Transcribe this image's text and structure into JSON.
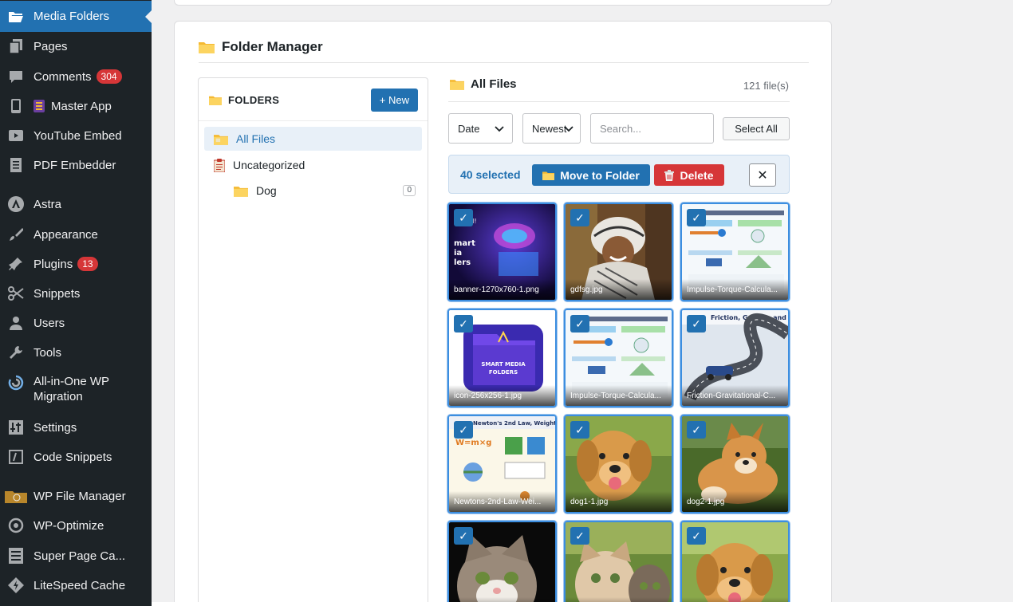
{
  "sidebar": {
    "items": [
      {
        "label": "Media Folders",
        "icon": "folder-open-icon",
        "active": true
      },
      {
        "label": "Pages",
        "icon": "pages-icon"
      },
      {
        "label": "Comments",
        "icon": "comment-icon",
        "badge": "304"
      },
      {
        "label": "Master App",
        "icon": "mobile-icon",
        "prefix_icon": "app-logo-icon"
      },
      {
        "label": "YouTube Embed",
        "icon": "video-icon"
      },
      {
        "label": "PDF Embedder",
        "icon": "document-icon"
      },
      {
        "label": "Astra",
        "icon": "astra-icon"
      },
      {
        "label": "Appearance",
        "icon": "brush-icon"
      },
      {
        "label": "Plugins",
        "icon": "plugin-icon",
        "badge": "13"
      },
      {
        "label": "Snippets",
        "icon": "scissors-icon"
      },
      {
        "label": "Users",
        "icon": "user-icon"
      },
      {
        "label": "Tools",
        "icon": "wrench-icon"
      },
      {
        "label": "All-in-One WP Migration",
        "icon": "migration-icon"
      },
      {
        "label": "Settings",
        "icon": "sliders-icon"
      },
      {
        "label": "Code Snippets",
        "icon": "code-icon"
      },
      {
        "label": "WP File Manager",
        "icon": "file-manager-icon"
      },
      {
        "label": "WP-Optimize",
        "icon": "optimize-icon"
      },
      {
        "label": "Super Page Ca...",
        "icon": "cache-icon"
      },
      {
        "label": "LiteSpeed Cache",
        "icon": "litespeed-icon"
      }
    ]
  },
  "folder_manager": {
    "title": "Folder Manager",
    "folders_panel": {
      "title": "FOLDERS",
      "new_button": "+ New",
      "items": [
        {
          "label": "All Files",
          "selected": true
        },
        {
          "label": "Uncategorized"
        },
        {
          "label": "Dog",
          "count": "0"
        }
      ]
    },
    "files_panel": {
      "title": "All Files",
      "file_count": "121 file(s)",
      "sort_by": "Date",
      "order": "Newest",
      "search_placeholder": "Search...",
      "select_all": "Select All",
      "selection": {
        "count_text": "40 selected",
        "move_button": "Move to Folder",
        "delete_button": "Delete",
        "close_button": "✕"
      },
      "files": [
        {
          "name": "banner-1270x760-1.png",
          "checked": true
        },
        {
          "name": "gdfsg.jpg",
          "checked": true
        },
        {
          "name": "Impulse-Torque-Calcula...",
          "checked": true
        },
        {
          "name": "icon-256x256-1.jpg",
          "checked": true
        },
        {
          "name": "Impulse-Torque-Calcula...",
          "checked": true
        },
        {
          "name": "Friction-Gravitational-C...",
          "checked": true
        },
        {
          "name": "Newtons-2nd-Law-Wei...",
          "checked": true
        },
        {
          "name": "dog1-1.jpg",
          "checked": true
        },
        {
          "name": "dog2-1.jpg",
          "checked": true
        },
        {
          "name": "",
          "checked": true
        },
        {
          "name": "",
          "checked": true
        },
        {
          "name": "",
          "checked": true
        }
      ]
    }
  },
  "colors": {
    "sidebar_bg": "#1d2327",
    "accent": "#2271b1",
    "danger": "#d63638",
    "folder": "#f5b932"
  }
}
